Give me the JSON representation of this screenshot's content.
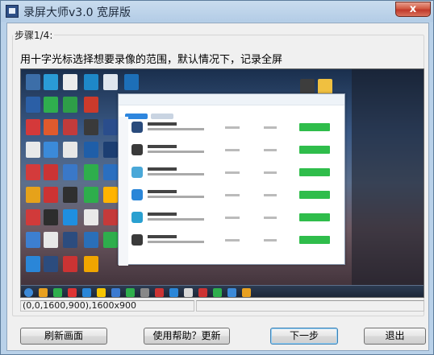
{
  "window": {
    "title": "录屏大师v3.0 宽屏版",
    "close_label": "x"
  },
  "step": {
    "legend": "步骤1/4:",
    "instruction": "用十字光标选择想要录像的范围，默认情况下，记录全屏"
  },
  "status": {
    "region": "(0,0,1600,900),1600x900",
    "secondary": ""
  },
  "buttons": {
    "refresh": "刷新画面",
    "help": "使用帮助？更新",
    "next": "下一步",
    "exit": "退出"
  },
  "colors": {
    "title_bar": "#b3cce6",
    "close_button": "#c0392b",
    "preview_accent": "#2fbd4b"
  }
}
